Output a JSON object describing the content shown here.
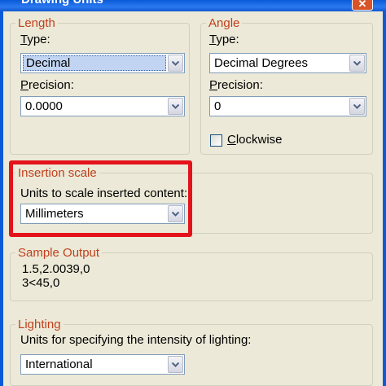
{
  "window": {
    "title": "Drawing Units"
  },
  "length": {
    "legend": "Length",
    "type_label_first": "T",
    "type_label_rest": "ype:",
    "type_value": "Decimal",
    "precision_label_first": "P",
    "precision_label_rest": "recision:",
    "precision_value": "0.0000"
  },
  "angle": {
    "legend": "Angle",
    "type_label_first": "T",
    "type_label_rest": "ype:",
    "type_value": "Decimal Degrees",
    "precision_label_first": "P",
    "precision_label_rest": "recision:",
    "precision_value": "0",
    "clockwise_label_first": "C",
    "clockwise_label_rest": "lockwise",
    "clockwise_checked": false
  },
  "insertion": {
    "legend": "Insertion scale",
    "label": "Units to scale inserted content:",
    "value": "Millimeters"
  },
  "sample": {
    "legend": "Sample Output",
    "lines": [
      "1.5,2.0039,0",
      "3<45,0"
    ]
  },
  "lighting": {
    "legend": "Lighting",
    "label": "Units for specifying the intensity of lighting:",
    "value": "International"
  },
  "colors": {
    "legend": "#c0401c",
    "highlight": "#e4131b",
    "selection": "#c1d4f2"
  }
}
